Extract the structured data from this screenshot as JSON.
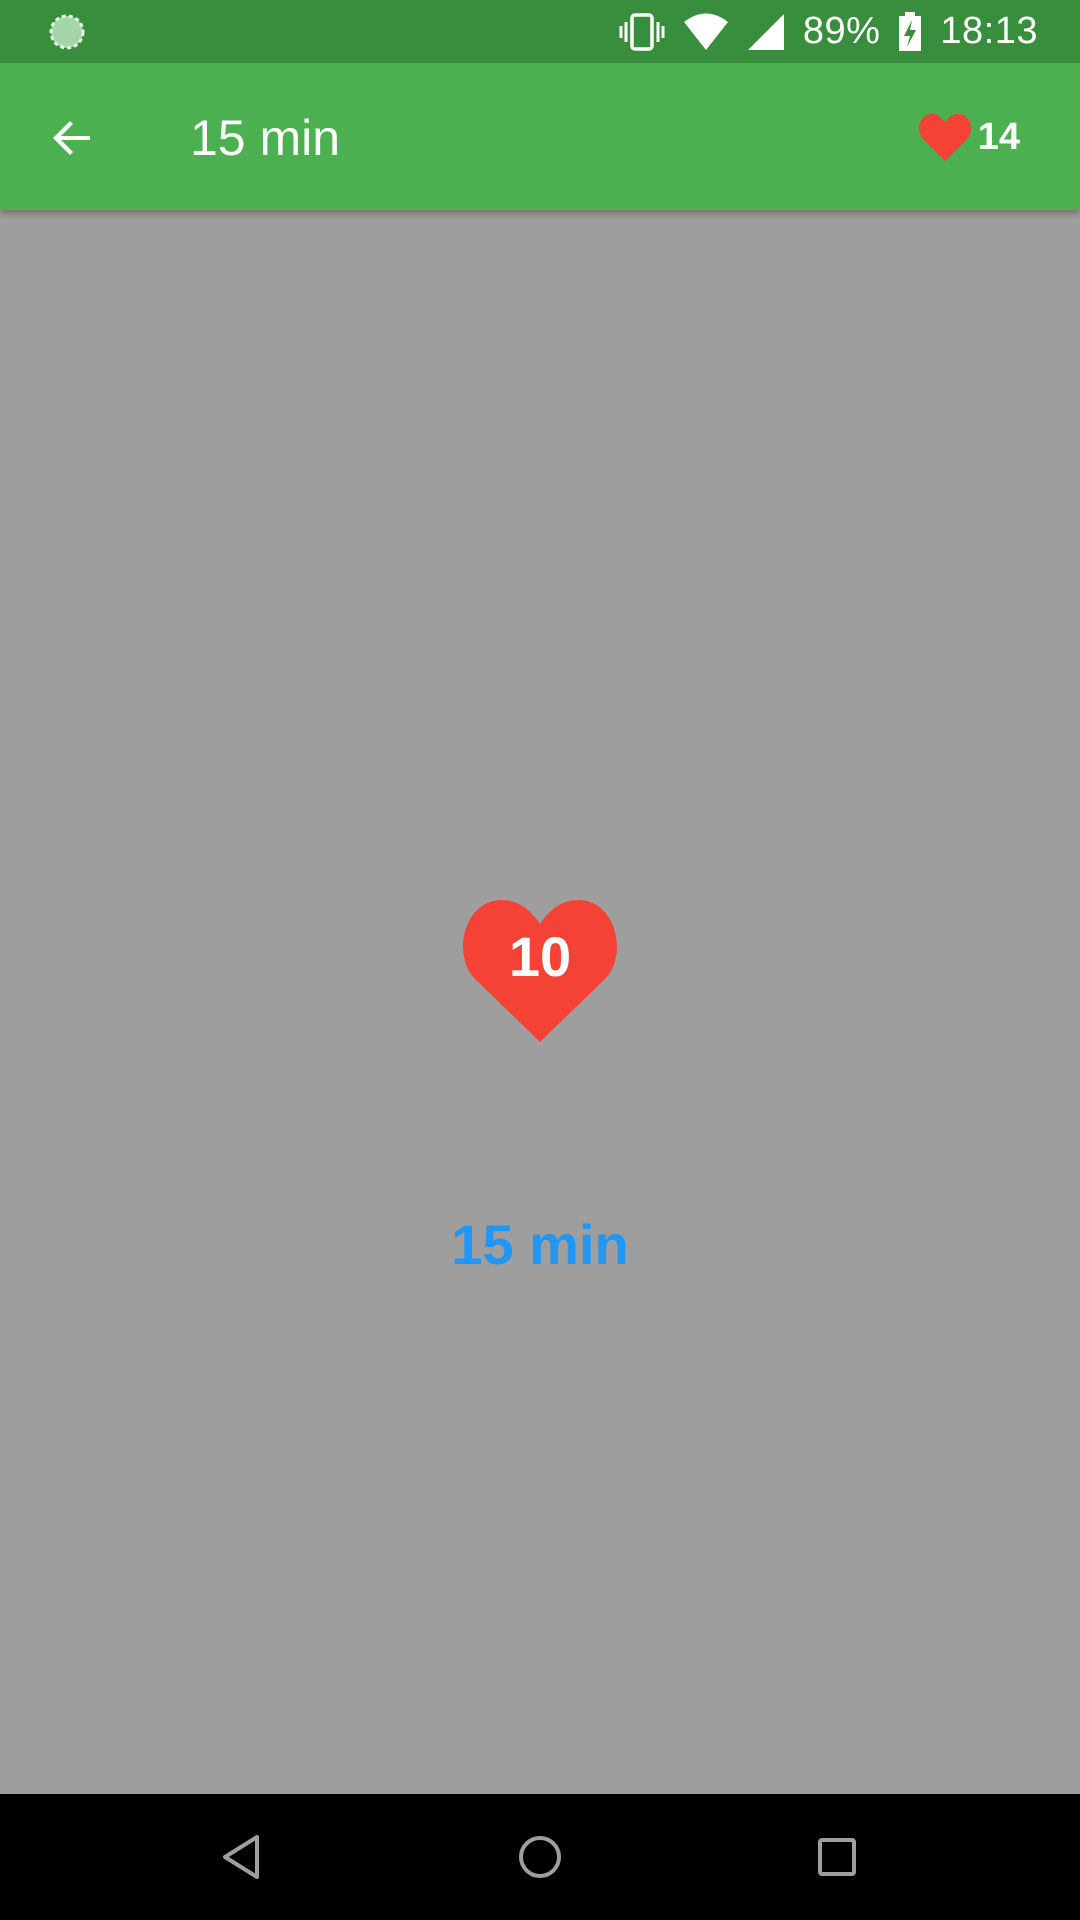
{
  "status_bar": {
    "battery": "89%",
    "time": "18:13"
  },
  "app_bar": {
    "title": "15 min",
    "lives_count": "14"
  },
  "main": {
    "heart_value": "10",
    "duration_label": "15 min"
  },
  "colors": {
    "status_bar": "#388e3c",
    "app_bar": "#4caf50",
    "heart": "#f44336",
    "duration_text": "#2196f3",
    "background": "#9e9e9e"
  },
  "icons": {
    "status_left": "loading-circle-icon",
    "vibrate": "vibrate-icon",
    "wifi": "wifi-icon",
    "signal": "cell-signal-icon",
    "battery": "battery-charging-icon",
    "back": "arrow-back-icon",
    "lives": "heart-icon",
    "nav_back": "nav-back-icon",
    "nav_home": "nav-home-icon",
    "nav_recents": "nav-recents-icon"
  }
}
